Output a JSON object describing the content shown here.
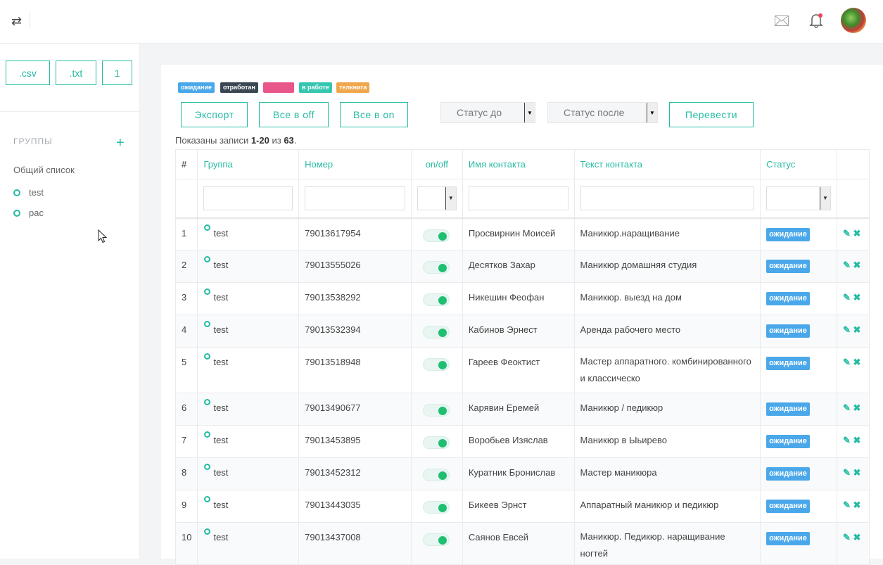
{
  "topbar": {
    "swap_icon": "⇄",
    "icons": [
      "swap-icon",
      "mail-icon",
      "bell-icon",
      "avatar"
    ]
  },
  "sidebar": {
    "file_buttons": [
      ".csv",
      ".txt",
      "1"
    ],
    "groups_title": "ГРУППЫ",
    "add_label": "+",
    "all_list": "Общий список",
    "groups": [
      "test",
      "рас"
    ]
  },
  "legend": [
    {
      "label": "ожидание",
      "color": "#4aa8ea"
    },
    {
      "label": "отработан",
      "color": "#3a4652"
    },
    {
      "label": "",
      "color": "#e9578a"
    },
    {
      "label": "в работе",
      "color": "#35c6b0"
    },
    {
      "label": "телкнига",
      "color": "#f0a64b"
    }
  ],
  "actions": {
    "export": "Экспорт",
    "all_off": "Все в off",
    "all_on": "Все в on",
    "status_before": "Статус до",
    "status_after": "Статус после",
    "translate": "Перевести"
  },
  "records": {
    "prefix": "Показаны записи ",
    "range": "1-20",
    "mid": " из ",
    "total": "63",
    "suffix": "."
  },
  "table": {
    "headers": [
      "#",
      "Группа",
      "Номер",
      "on/off",
      "Имя контакта",
      "Текст контакта",
      "Статус",
      ""
    ],
    "rows": [
      {
        "n": "1",
        "group": "test",
        "phone": "79013617954",
        "name": "Просвирнин Моисей",
        "text": "Маникюр.наращивание",
        "status": "ожидание"
      },
      {
        "n": "2",
        "group": "test",
        "phone": "79013555026",
        "name": "Десятков Захар",
        "text": "Маникюр домашняя студия",
        "status": "ожидание"
      },
      {
        "n": "3",
        "group": "test",
        "phone": "79013538292",
        "name": "Никешин Феофан",
        "text": "Маникюр. выезд на дом",
        "status": "ожидание"
      },
      {
        "n": "4",
        "group": "test",
        "phone": "79013532394",
        "name": "Кабинов Эрнест",
        "text": "Аренда рабочего место",
        "status": "ожидание"
      },
      {
        "n": "5",
        "group": "test",
        "phone": "79013518948",
        "name": "Гареев Феоктист",
        "text": "Мастер аппаратного. комбинированного и классическо",
        "status": "ожидание"
      },
      {
        "n": "6",
        "group": "test",
        "phone": "79013490677",
        "name": "Карявин Еремей",
        "text": "Маникюр / педикюр",
        "status": "ожидание"
      },
      {
        "n": "7",
        "group": "test",
        "phone": "79013453895",
        "name": "Воробьев Изяслав",
        "text": "Маникюр в Ыьирево",
        "status": "ожидание"
      },
      {
        "n": "8",
        "group": "test",
        "phone": "79013452312",
        "name": "Куратник Бронислав",
        "text": "Мастер маникюра",
        "status": "ожидание"
      },
      {
        "n": "9",
        "group": "test",
        "phone": "79013443035",
        "name": "Бикеев Эрнст",
        "text": "Аппаратный маникюр и педикюр",
        "status": "ожидание"
      },
      {
        "n": "10",
        "group": "test",
        "phone": "79013437008",
        "name": "Саянов Евсей",
        "text": "Маникюр. Педикюр. наращивание ногтей",
        "status": "ожидание"
      }
    ]
  }
}
